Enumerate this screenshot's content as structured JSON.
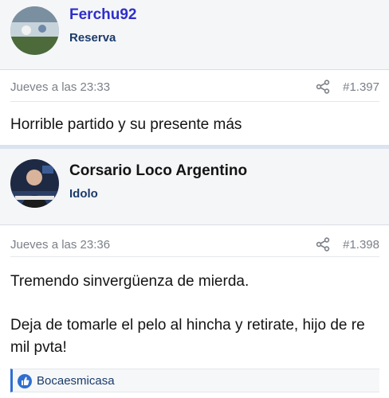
{
  "posts": [
    {
      "username": "Ferchu92",
      "role": "Reserva",
      "date": "Jueves a las 23:33",
      "number": "#1.397",
      "body": "Horrible partido y su presente más"
    },
    {
      "username": "Corsario Loco Argentino",
      "role": "Idolo",
      "date": "Jueves a las 23:36",
      "number": "#1.398",
      "body_p1": "Tremendo sinvergüenza de mierda.",
      "body_p2": "Deja de tomarle el pelo al hincha y retirate, hijo de re mil pvta!",
      "reaction_user": "Bocaesmicasa"
    }
  ],
  "colors": {
    "username1": "#2f2fc9",
    "username2": "#141414",
    "role": "#1a3b6b",
    "meta": "#7b8088",
    "accent": "#2f6fd0"
  },
  "icons": {
    "share": "share-icon",
    "like": "like-icon"
  }
}
